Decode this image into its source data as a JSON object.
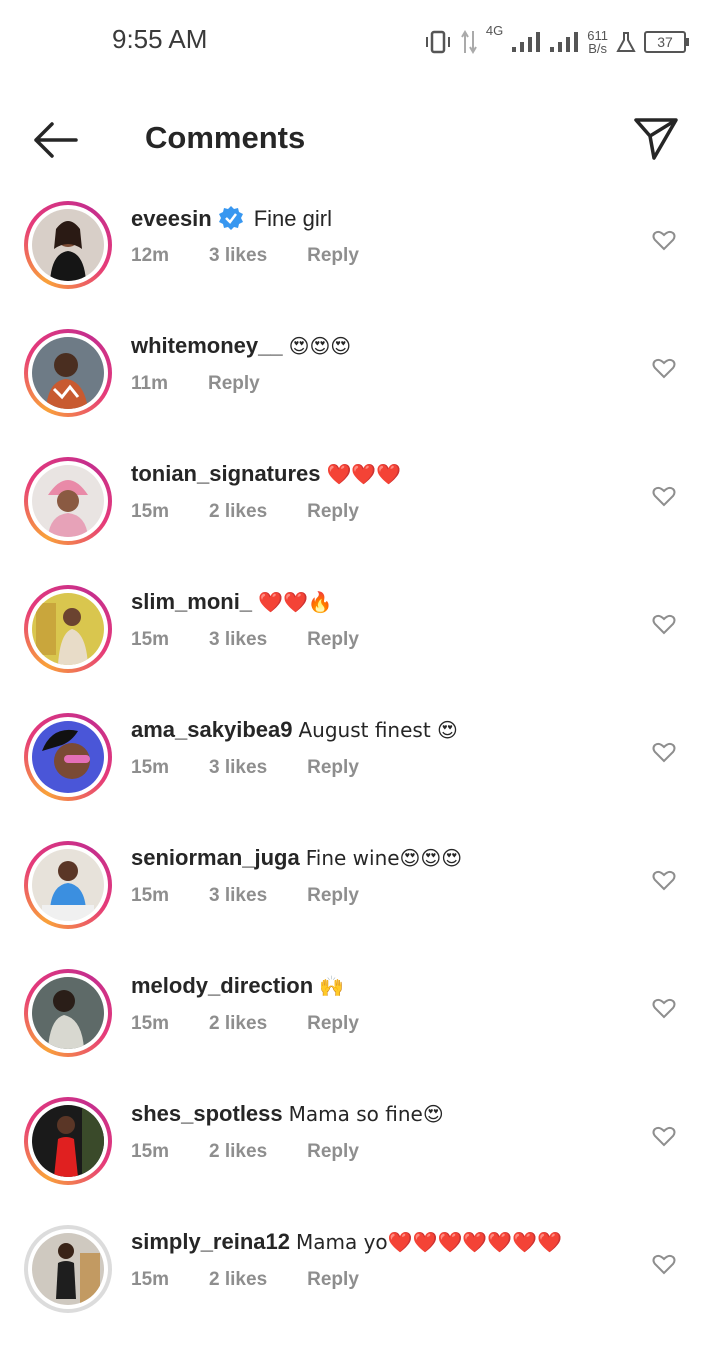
{
  "status_bar": {
    "time": "9:55 AM",
    "network_type": "4G",
    "speed_value": "611",
    "speed_unit": "B/s",
    "battery": "37"
  },
  "header": {
    "title": "Comments",
    "back_icon": "arrow-left-icon",
    "send_icon": "paper-plane-icon"
  },
  "colors": {
    "ring_gradient": [
      "#f9a13a",
      "#e53a7a",
      "#c52e8d"
    ],
    "meta_gray": "#8e8e8e",
    "verified_blue": "#3897f0"
  },
  "comments": [
    {
      "username": "eveesin",
      "verified": true,
      "text": "Fine girl",
      "time": "12m",
      "likes": "3 likes",
      "reply": "Reply",
      "ring": true
    },
    {
      "username": "whitemoney__",
      "verified": false,
      "text": "😍😍😍",
      "time": "11m",
      "likes": "",
      "reply": "Reply",
      "ring": true
    },
    {
      "username": "tonian_signatures",
      "verified": false,
      "text": "❤️❤️❤️",
      "time": "15m",
      "likes": "2 likes",
      "reply": "Reply",
      "ring": true
    },
    {
      "username": "slim_moni_",
      "verified": false,
      "text": "❤️❤️🔥",
      "time": "15m",
      "likes": "3 likes",
      "reply": "Reply",
      "ring": true
    },
    {
      "username": "ama_sakyibea9",
      "verified": false,
      "text": "August finest 😍",
      "time": "15m",
      "likes": "3 likes",
      "reply": "Reply",
      "ring": true
    },
    {
      "username": "seniorman_juga",
      "verified": false,
      "text": "Fine wine😍😍😍",
      "time": "15m",
      "likes": "3 likes",
      "reply": "Reply",
      "ring": true
    },
    {
      "username": "melody_direction",
      "verified": false,
      "text": "🙌",
      "time": "15m",
      "likes": "2 likes",
      "reply": "Reply",
      "ring": true
    },
    {
      "username": "shes_spotless",
      "verified": false,
      "text": "Mama so fine😍",
      "time": "15m",
      "likes": "2 likes",
      "reply": "Reply",
      "ring": true
    },
    {
      "username": "simply_reina12",
      "verified": false,
      "text": "Mama yo❤️❤️❤️❤️❤️❤️❤️",
      "time": "15m",
      "likes": "2 likes",
      "reply": "Reply",
      "ring": false
    }
  ]
}
